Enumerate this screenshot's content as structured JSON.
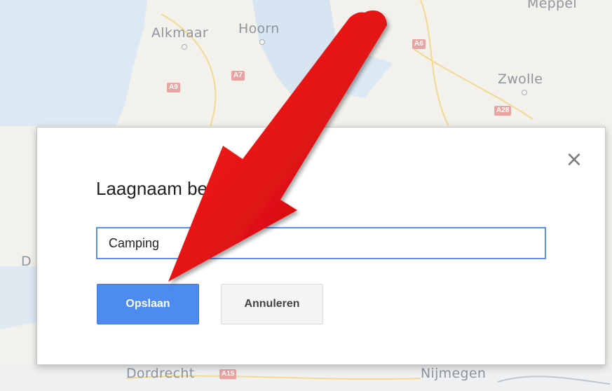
{
  "map": {
    "cities": {
      "alkmaar": "Alkmaar",
      "hoorn": "Hoorn",
      "meppel": "Meppel",
      "zwolle": "Zwolle",
      "dordrecht": "Dordrecht",
      "nijmegen": "Nijmegen",
      "partial_left": "D"
    },
    "roads": {
      "a9": "A9",
      "a7": "A7",
      "a6": "A6",
      "a28": "A28",
      "a15": "A15"
    }
  },
  "dialog": {
    "title": "Laagnaam bewerken",
    "input_value": "Camping",
    "save_label": "Opslaan",
    "cancel_label": "Annuleren",
    "close_glyph": "×"
  },
  "colors": {
    "primary_button": "#4d8bf0",
    "annotation_arrow": "#e8000a"
  }
}
